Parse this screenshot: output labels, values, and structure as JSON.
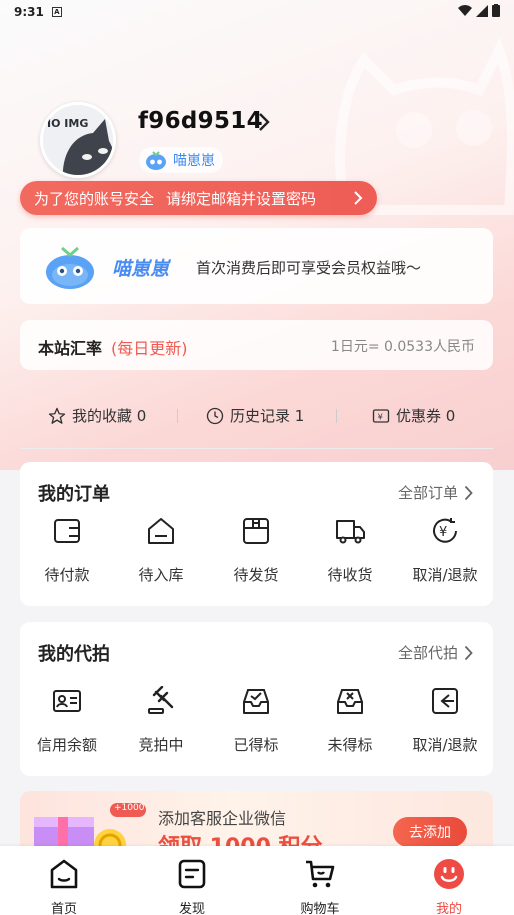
{
  "status": {
    "time": "9:31",
    "a_label": "A"
  },
  "profile": {
    "username": "f96d9514",
    "level_name": "喵崽崽"
  },
  "security": {
    "part1": "为了您的账号安全",
    "part2": "请绑定邮箱并设置密码"
  },
  "member": {
    "name": "喵崽崽",
    "desc": "首次消费后即可享受会员权益哦～"
  },
  "rate": {
    "label": "本站汇率",
    "tag": "(每日更新)",
    "value": "1日元= 0.0533人民币"
  },
  "quick": [
    {
      "label": "我的收藏 0",
      "icon": "star-icon"
    },
    {
      "label": "历史记录 1",
      "icon": "clock-icon"
    },
    {
      "label": "优惠券 0",
      "icon": "coupon-icon"
    }
  ],
  "orders": {
    "title": "我的订单",
    "more": "全部订单",
    "items": [
      {
        "label": "待付款",
        "icon": "wallet-icon"
      },
      {
        "label": "待入库",
        "icon": "warehouse-icon"
      },
      {
        "label": "待发货",
        "icon": "package-icon"
      },
      {
        "label": "待收货",
        "icon": "truck-icon"
      },
      {
        "label": "取消/退款",
        "icon": "refund-icon"
      }
    ]
  },
  "bids": {
    "title": "我的代拍",
    "more": "全部代拍",
    "items": [
      {
        "label": "信用余额",
        "icon": "id-card-icon"
      },
      {
        "label": "竞拍中",
        "icon": "gavel-icon"
      },
      {
        "label": "已得标",
        "icon": "inbox-check-icon"
      },
      {
        "label": "未得标",
        "icon": "inbox-x-icon"
      },
      {
        "label": "取消/退款",
        "icon": "return-icon"
      }
    ]
  },
  "banner": {
    "badge": "+1000",
    "line1": "添加客服企业微信",
    "line2": "领取 1000 积分",
    "button": "去添加"
  },
  "tabs": [
    {
      "label": "首页",
      "icon": "home-icon"
    },
    {
      "label": "发现",
      "icon": "discover-icon"
    },
    {
      "label": "购物车",
      "icon": "cart-icon"
    },
    {
      "label": "我的",
      "icon": "profile-face-icon",
      "active": true
    }
  ],
  "colors": {
    "accent": "#ef4b45",
    "member_blue": "#4a8df0"
  }
}
